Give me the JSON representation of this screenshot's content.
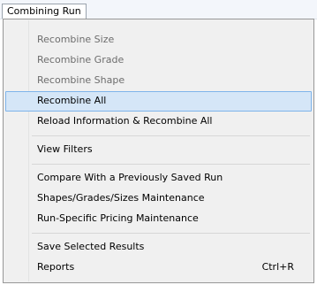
{
  "menubar": {
    "title": "Combining Run"
  },
  "menu": {
    "items": [
      {
        "label": "Recombine Size",
        "disabled": true
      },
      {
        "label": "Recombine Grade",
        "disabled": true
      },
      {
        "label": "Recombine Shape",
        "disabled": true
      },
      {
        "label": "Recombine All",
        "highlighted": true
      },
      {
        "label": "Reload Information & Recombine All"
      },
      {
        "label": "View Filters"
      },
      {
        "label": "Compare With a Previously Saved Run"
      },
      {
        "label": "Shapes/Grades/Sizes Maintenance"
      },
      {
        "label": "Run-Specific Pricing Maintenance"
      },
      {
        "label": "Save Selected Results"
      },
      {
        "label": "Reports",
        "shortcut": "Ctrl+R"
      }
    ]
  }
}
